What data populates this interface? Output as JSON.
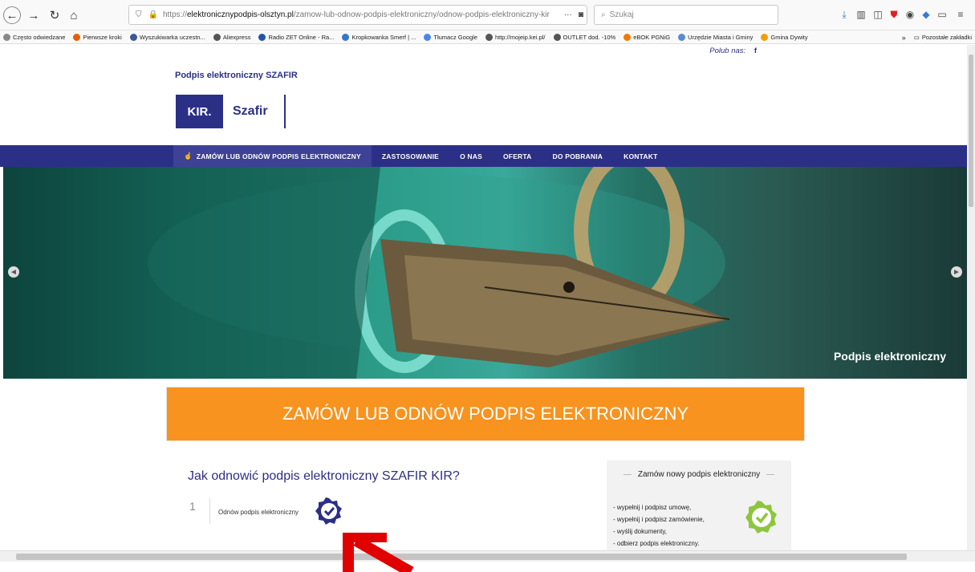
{
  "browser": {
    "url_prefix": "https://",
    "url_host": "elektronicznypodpis-olsztyn.pl",
    "url_path": "/zamow-lub-odnow-podpis-elektroniczny/odnow-podpis-elektroniczny-kir",
    "url_more": "···",
    "search_placeholder": "Szukaj"
  },
  "bookmarks": [
    {
      "label": "Często odwiedzane",
      "color": "#888888"
    },
    {
      "label": "Pierwsze kroki",
      "color": "#e66000"
    },
    {
      "label": "Wyszukiwarka uczestn...",
      "color": "#3b5998"
    },
    {
      "label": "Aliexpress",
      "color": "#555555"
    },
    {
      "label": "Radio ZET Online - Ra...",
      "color": "#2255aa"
    },
    {
      "label": "Kropkowanka Smerf | ...",
      "color": "#3377cc"
    },
    {
      "label": "Tłumacz Google",
      "color": "#4a86e8"
    },
    {
      "label": "http://mojeip.kei.pl/",
      "color": "#555555"
    },
    {
      "label": "OUTLET dod. -10%",
      "color": "#555555"
    },
    {
      "label": "eBOK PGNiG",
      "color": "#f07a00"
    },
    {
      "label": "Urzędzie Miasta i Gminy",
      "color": "#5b8bd0"
    },
    {
      "label": "Gmina Dywity",
      "color": "#f0a000"
    }
  ],
  "bookmarks_other": "Pozostałe zakładki",
  "site": {
    "like_label": "Polub nas:",
    "like_icon": "f",
    "title": "Podpis elektroniczny SZAFIR",
    "logo_kir": "KIR.",
    "logo_szafir": "Szafir"
  },
  "nav": [
    {
      "label": "ZAMÓW LUB ODNÓW PODPIS ELEKTRONICZNY"
    },
    {
      "label": "ZASTOSOWANIE"
    },
    {
      "label": "O NAS"
    },
    {
      "label": "OFERTA"
    },
    {
      "label": "DO POBRANIA"
    },
    {
      "label": "KONTAKT"
    }
  ],
  "hero": {
    "caption": "Podpis elektroniczny"
  },
  "cta": "ZAMÓW LUB ODNÓW PODPIS ELEKTRONICZNY",
  "section_title": "Jak odnowić podpis elektroniczny SZAFIR KIR?",
  "step": {
    "number": "1",
    "label": "Odnów podpis elektroniczny"
  },
  "sidebar": {
    "title": "Zamów nowy podpis elektroniczny",
    "items": [
      "- wypełnij i podpisz umowę,",
      "- wypełnij i podpisz zamówienie,",
      "- wyślij dokumenty,",
      "- odbierz podpis elektroniczny."
    ]
  },
  "colors": {
    "brand_blue": "#2c2f86",
    "cta_orange": "#f7931e",
    "check_green": "#8cc63f",
    "annotation_red": "#e00000"
  }
}
